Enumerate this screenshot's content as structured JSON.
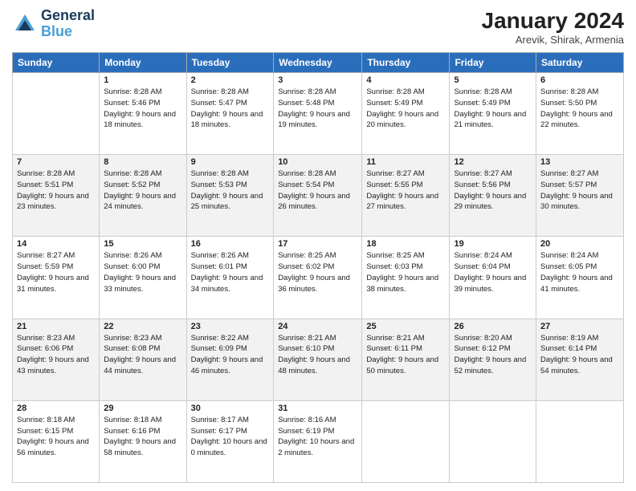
{
  "header": {
    "logo_line1": "General",
    "logo_line2": "Blue",
    "title": "January 2024",
    "subtitle": "Arevik, Shirak, Armenia"
  },
  "columns": [
    "Sunday",
    "Monday",
    "Tuesday",
    "Wednesday",
    "Thursday",
    "Friday",
    "Saturday"
  ],
  "weeks": [
    [
      {
        "day": "",
        "sunrise": "",
        "sunset": "",
        "daylight": ""
      },
      {
        "day": "1",
        "sunrise": "Sunrise: 8:28 AM",
        "sunset": "Sunset: 5:46 PM",
        "daylight": "Daylight: 9 hours and 18 minutes."
      },
      {
        "day": "2",
        "sunrise": "Sunrise: 8:28 AM",
        "sunset": "Sunset: 5:47 PM",
        "daylight": "Daylight: 9 hours and 18 minutes."
      },
      {
        "day": "3",
        "sunrise": "Sunrise: 8:28 AM",
        "sunset": "Sunset: 5:48 PM",
        "daylight": "Daylight: 9 hours and 19 minutes."
      },
      {
        "day": "4",
        "sunrise": "Sunrise: 8:28 AM",
        "sunset": "Sunset: 5:49 PM",
        "daylight": "Daylight: 9 hours and 20 minutes."
      },
      {
        "day": "5",
        "sunrise": "Sunrise: 8:28 AM",
        "sunset": "Sunset: 5:49 PM",
        "daylight": "Daylight: 9 hours and 21 minutes."
      },
      {
        "day": "6",
        "sunrise": "Sunrise: 8:28 AM",
        "sunset": "Sunset: 5:50 PM",
        "daylight": "Daylight: 9 hours and 22 minutes."
      }
    ],
    [
      {
        "day": "7",
        "sunrise": "Sunrise: 8:28 AM",
        "sunset": "Sunset: 5:51 PM",
        "daylight": "Daylight: 9 hours and 23 minutes."
      },
      {
        "day": "8",
        "sunrise": "Sunrise: 8:28 AM",
        "sunset": "Sunset: 5:52 PM",
        "daylight": "Daylight: 9 hours and 24 minutes."
      },
      {
        "day": "9",
        "sunrise": "Sunrise: 8:28 AM",
        "sunset": "Sunset: 5:53 PM",
        "daylight": "Daylight: 9 hours and 25 minutes."
      },
      {
        "day": "10",
        "sunrise": "Sunrise: 8:28 AM",
        "sunset": "Sunset: 5:54 PM",
        "daylight": "Daylight: 9 hours and 26 minutes."
      },
      {
        "day": "11",
        "sunrise": "Sunrise: 8:27 AM",
        "sunset": "Sunset: 5:55 PM",
        "daylight": "Daylight: 9 hours and 27 minutes."
      },
      {
        "day": "12",
        "sunrise": "Sunrise: 8:27 AM",
        "sunset": "Sunset: 5:56 PM",
        "daylight": "Daylight: 9 hours and 29 minutes."
      },
      {
        "day": "13",
        "sunrise": "Sunrise: 8:27 AM",
        "sunset": "Sunset: 5:57 PM",
        "daylight": "Daylight: 9 hours and 30 minutes."
      }
    ],
    [
      {
        "day": "14",
        "sunrise": "Sunrise: 8:27 AM",
        "sunset": "Sunset: 5:59 PM",
        "daylight": "Daylight: 9 hours and 31 minutes."
      },
      {
        "day": "15",
        "sunrise": "Sunrise: 8:26 AM",
        "sunset": "Sunset: 6:00 PM",
        "daylight": "Daylight: 9 hours and 33 minutes."
      },
      {
        "day": "16",
        "sunrise": "Sunrise: 8:26 AM",
        "sunset": "Sunset: 6:01 PM",
        "daylight": "Daylight: 9 hours and 34 minutes."
      },
      {
        "day": "17",
        "sunrise": "Sunrise: 8:25 AM",
        "sunset": "Sunset: 6:02 PM",
        "daylight": "Daylight: 9 hours and 36 minutes."
      },
      {
        "day": "18",
        "sunrise": "Sunrise: 8:25 AM",
        "sunset": "Sunset: 6:03 PM",
        "daylight": "Daylight: 9 hours and 38 minutes."
      },
      {
        "day": "19",
        "sunrise": "Sunrise: 8:24 AM",
        "sunset": "Sunset: 6:04 PM",
        "daylight": "Daylight: 9 hours and 39 minutes."
      },
      {
        "day": "20",
        "sunrise": "Sunrise: 8:24 AM",
        "sunset": "Sunset: 6:05 PM",
        "daylight": "Daylight: 9 hours and 41 minutes."
      }
    ],
    [
      {
        "day": "21",
        "sunrise": "Sunrise: 8:23 AM",
        "sunset": "Sunset: 6:06 PM",
        "daylight": "Daylight: 9 hours and 43 minutes."
      },
      {
        "day": "22",
        "sunrise": "Sunrise: 8:23 AM",
        "sunset": "Sunset: 6:08 PM",
        "daylight": "Daylight: 9 hours and 44 minutes."
      },
      {
        "day": "23",
        "sunrise": "Sunrise: 8:22 AM",
        "sunset": "Sunset: 6:09 PM",
        "daylight": "Daylight: 9 hours and 46 minutes."
      },
      {
        "day": "24",
        "sunrise": "Sunrise: 8:21 AM",
        "sunset": "Sunset: 6:10 PM",
        "daylight": "Daylight: 9 hours and 48 minutes."
      },
      {
        "day": "25",
        "sunrise": "Sunrise: 8:21 AM",
        "sunset": "Sunset: 6:11 PM",
        "daylight": "Daylight: 9 hours and 50 minutes."
      },
      {
        "day": "26",
        "sunrise": "Sunrise: 8:20 AM",
        "sunset": "Sunset: 6:12 PM",
        "daylight": "Daylight: 9 hours and 52 minutes."
      },
      {
        "day": "27",
        "sunrise": "Sunrise: 8:19 AM",
        "sunset": "Sunset: 6:14 PM",
        "daylight": "Daylight: 9 hours and 54 minutes."
      }
    ],
    [
      {
        "day": "28",
        "sunrise": "Sunrise: 8:18 AM",
        "sunset": "Sunset: 6:15 PM",
        "daylight": "Daylight: 9 hours and 56 minutes."
      },
      {
        "day": "29",
        "sunrise": "Sunrise: 8:18 AM",
        "sunset": "Sunset: 6:16 PM",
        "daylight": "Daylight: 9 hours and 58 minutes."
      },
      {
        "day": "30",
        "sunrise": "Sunrise: 8:17 AM",
        "sunset": "Sunset: 6:17 PM",
        "daylight": "Daylight: 10 hours and 0 minutes."
      },
      {
        "day": "31",
        "sunrise": "Sunrise: 8:16 AM",
        "sunset": "Sunset: 6:19 PM",
        "daylight": "Daylight: 10 hours and 2 minutes."
      },
      {
        "day": "",
        "sunrise": "",
        "sunset": "",
        "daylight": ""
      },
      {
        "day": "",
        "sunrise": "",
        "sunset": "",
        "daylight": ""
      },
      {
        "day": "",
        "sunrise": "",
        "sunset": "",
        "daylight": ""
      }
    ]
  ]
}
